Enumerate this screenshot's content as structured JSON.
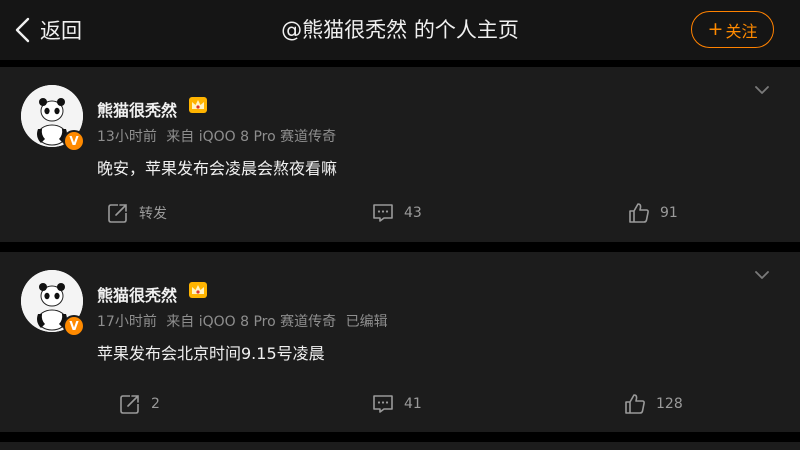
{
  "header": {
    "back_label": "返回",
    "title": "@熊猫很秃然 的个人主页",
    "follow_label": "关注",
    "follow_plus": "+"
  },
  "colors": {
    "accent": "#ff8200",
    "background": "#000000",
    "card": "#1c1c1c",
    "meta": "#8e8e8e"
  },
  "posts": [
    {
      "author": "熊猫很秃然",
      "verified_badge": "V",
      "time": "13小时前",
      "source": "来自 iQOO 8 Pro 赛道传奇",
      "edited": "",
      "text": "晚安，苹果发布会凌晨会熬夜看嘛",
      "repost": "转发",
      "comments": "43",
      "likes": "91"
    },
    {
      "author": "熊猫很秃然",
      "verified_badge": "V",
      "time": "17小时前",
      "source": "来自 iQOO 8 Pro 赛道传奇",
      "edited": "已编辑",
      "text": "苹果发布会北京时间9.15号凌晨",
      "repost": "2",
      "comments": "41",
      "likes": "128"
    }
  ],
  "icons": [
    "chevron-left-icon",
    "chevron-down-icon",
    "crown-icon",
    "share-icon",
    "comment-icon",
    "thumbs-up-icon",
    "panda-avatar"
  ]
}
